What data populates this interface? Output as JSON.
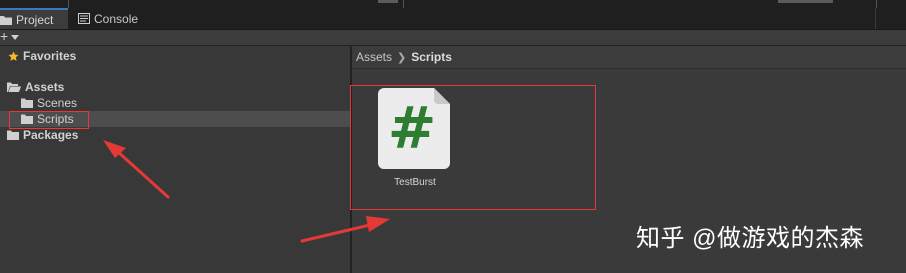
{
  "tabs": [
    {
      "label": "Project",
      "icon": "folder-icon"
    },
    {
      "label": "Console",
      "icon": "console-icon"
    }
  ],
  "toolbar": {
    "create_icon": "plus-icon"
  },
  "tree": {
    "favorites": "Favorites",
    "assets": "Assets",
    "scenes": "Scenes",
    "scripts": "Scripts",
    "packages": "Packages"
  },
  "breadcrumb": {
    "root": "Assets",
    "current": "Scripts"
  },
  "asset": {
    "name": "TestBurst",
    "glyph": "#"
  },
  "watermark": "知乎 @做游戏的杰森",
  "colors": {
    "highlight": "#e53935",
    "csharp_green": "#2e7d32",
    "star": "#f5b928",
    "accent_tab": "#3a79bb"
  }
}
